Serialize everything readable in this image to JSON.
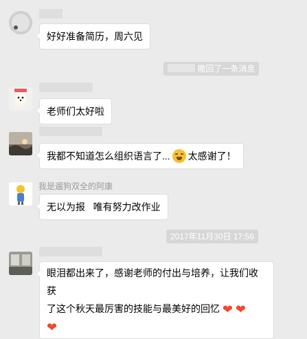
{
  "colors": {
    "background": "#ebebeb",
    "bubble": "#ffffff",
    "system_pill": "#d7d7d7",
    "name_text": "#9a9a9a",
    "heart": "#f0492d"
  },
  "messages": [
    {
      "text": "好好准备简历，周六见"
    },
    {
      "system": "撤回了一条消息"
    },
    {
      "text": "老师们太好啦"
    },
    {
      "text_before": "我都不知道怎么组织语言了...",
      "emoji": "crying-face",
      "text_after": "太感谢了！"
    },
    {
      "sender": "我是遛狗双全的阿康",
      "text": "无以为报   唯有努力改作业"
    },
    {
      "timestamp": "2017年11月30日 17:56"
    },
    {
      "line1": "眼泪都出来了，感谢老师的付出与培养，让我们收获",
      "line2": "了这个秋天最厉害的技能与最美好的回忆",
      "emoji": [
        "heart",
        "heart",
        "heart"
      ]
    }
  ]
}
